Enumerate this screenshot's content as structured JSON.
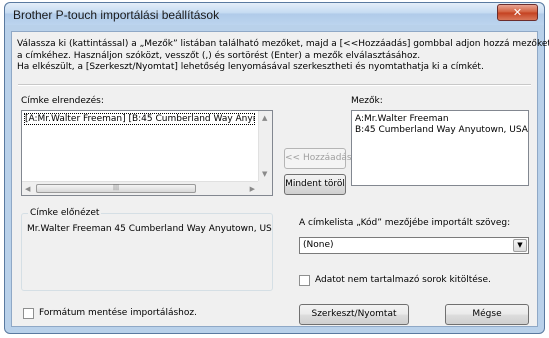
{
  "window": {
    "title": "Brother P-touch importálási beállítások",
    "close_label": "✕"
  },
  "instructions": {
    "line1": "Válassza ki (kattintással) a „Mezők” listában található mezőket, majd a [<<Hozzáadás] gombbal adjon hozzá mezőket",
    "line2": "a címkéhez. Használjon szóközt, vesszőt (,) és sortörést (Enter) a mezők elválasztásához.",
    "line3": "Ha elkészült, a [Szerkeszt/Nyomtat] lehetőség lenyomásával szerkesztheti és nyomtathatja ki a címkét."
  },
  "layout_panel": {
    "label": "Címke elrendezés:",
    "content": "[A:Mr.Walter Freeman] [B:45 Cumberland Way Anyı"
  },
  "fields_panel": {
    "label": "Mezők:",
    "items": [
      "A:Mr.Walter Freeman",
      "B:45 Cumberland Way Anyutown, USA !"
    ]
  },
  "buttons": {
    "add": "<< Hozzáadás",
    "clear_all": "Mindent töröl",
    "edit_print": "Szerkeszt/Nyomtat",
    "cancel": "Mégse"
  },
  "preview": {
    "title": "Címke előnézet",
    "text": "Mr.Walter Freeman 45 Cumberland Way Anyutown, US"
  },
  "code_field": {
    "label": "A címkelista „Kód” mezőjébe importált szöveg:",
    "selected": "(None)"
  },
  "checkboxes": {
    "fill_empty": "Adatot nem tartalmazó sorok kitöltése.",
    "save_format": "Formátum mentése importáláshoz."
  },
  "icons": {
    "close": "close-icon",
    "dropdown": "chevron-down-icon"
  },
  "colors": {
    "frame": "#b9d1ea",
    "client": "#f0f0f0",
    "close_button": "#c44120"
  }
}
